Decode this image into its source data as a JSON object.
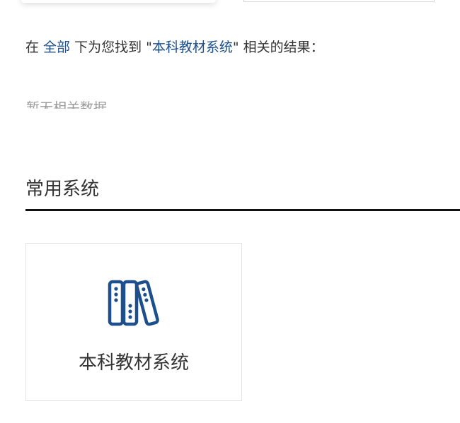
{
  "search_result": {
    "prefix": "在 ",
    "scope_link": "全部",
    "middle": " 下为您找到 \"",
    "query_link": "本科教材系统",
    "suffix": "\" 相关的结果："
  },
  "no_data_text": "暂无相关数据",
  "section": {
    "title": "常用系统"
  },
  "systems": [
    {
      "label": "本科教材系统",
      "icon": "books-icon"
    }
  ],
  "colors": {
    "link": "#1d4f8c",
    "icon": "#1d4f8c",
    "text": "#333333",
    "rule": "#111111"
  }
}
